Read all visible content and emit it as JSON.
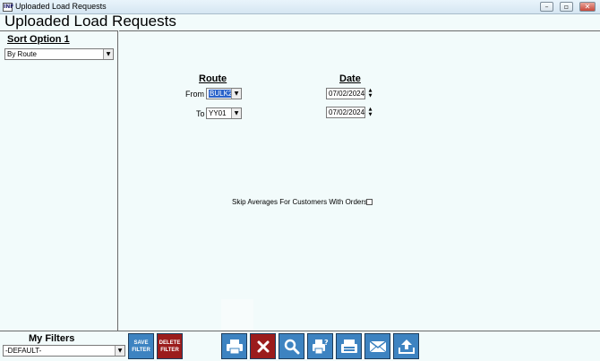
{
  "window": {
    "title": "Uploaded Load Requests",
    "app_icon_text": "INF"
  },
  "page": {
    "title": "Uploaded Load Requests"
  },
  "sort": {
    "label": "Sort Option 1",
    "selected": "By Route"
  },
  "route": {
    "heading": "Route",
    "from_label": "From",
    "from_value": "BULK2",
    "to_label": "To",
    "to_value": "YY01"
  },
  "date": {
    "heading": "Date",
    "from_value": "07/02/2024",
    "to_value": "07/02/2024"
  },
  "skip": {
    "label": "Skip Averages For Customers With Orders",
    "checked": false
  },
  "filters": {
    "label": "My Filters",
    "selected": "-DEFAULT-"
  },
  "buttons": {
    "save_filter": [
      "SAVE",
      "FILTER"
    ],
    "delete_filter": [
      "DELETE",
      "FILTER"
    ]
  },
  "colors": {
    "accent": "#3d83c1",
    "danger": "#9b1c1c",
    "selection": "#2a62c9"
  }
}
